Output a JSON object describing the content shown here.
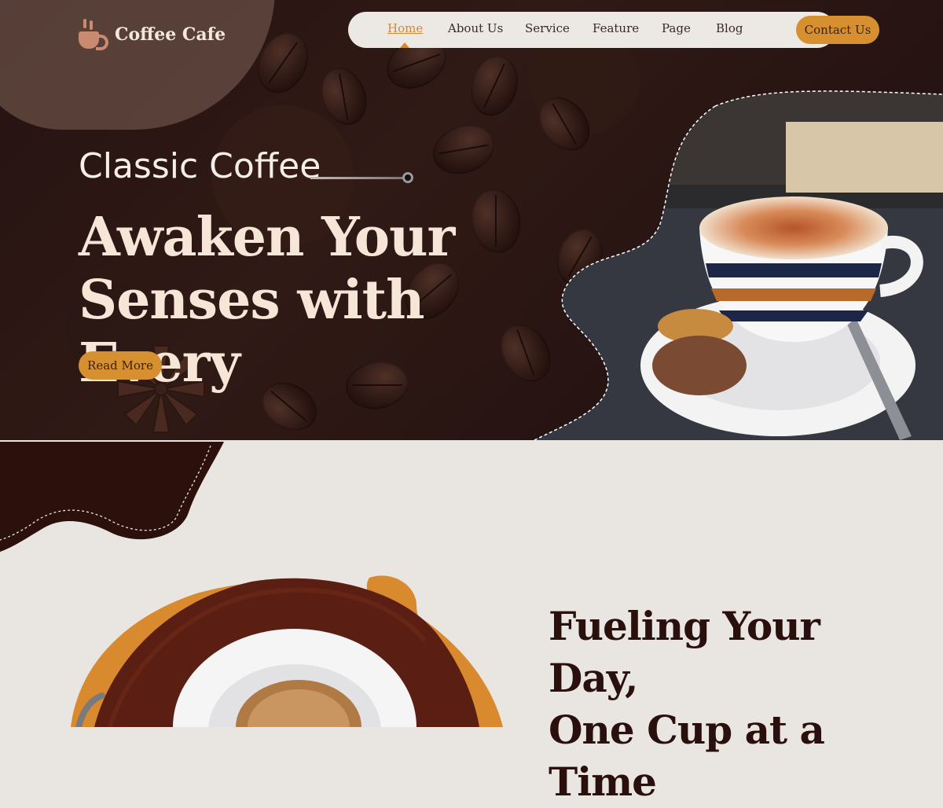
{
  "brand": {
    "name": "Coffee Cafe",
    "icon": "coffee-cup-icon"
  },
  "nav": {
    "items": [
      {
        "label": "Home",
        "active": true
      },
      {
        "label": "About Us"
      },
      {
        "label": "Service"
      },
      {
        "label": "Feature"
      },
      {
        "label": "Page"
      },
      {
        "label": "Blog"
      }
    ],
    "contact_label": "Contact Us"
  },
  "hero": {
    "kicker": "Classic Coffee",
    "headline_line1": "Awaken Your",
    "headline_line2": "Senses with Every",
    "cta_label": "Read More"
  },
  "section2": {
    "headline_line1": "Fueling Your Day,",
    "headline_line2": "One Cup at a Time"
  },
  "colors": {
    "accent": "#d7902f",
    "dark_brown": "#2a100c",
    "cream": "#f5e6d8"
  }
}
